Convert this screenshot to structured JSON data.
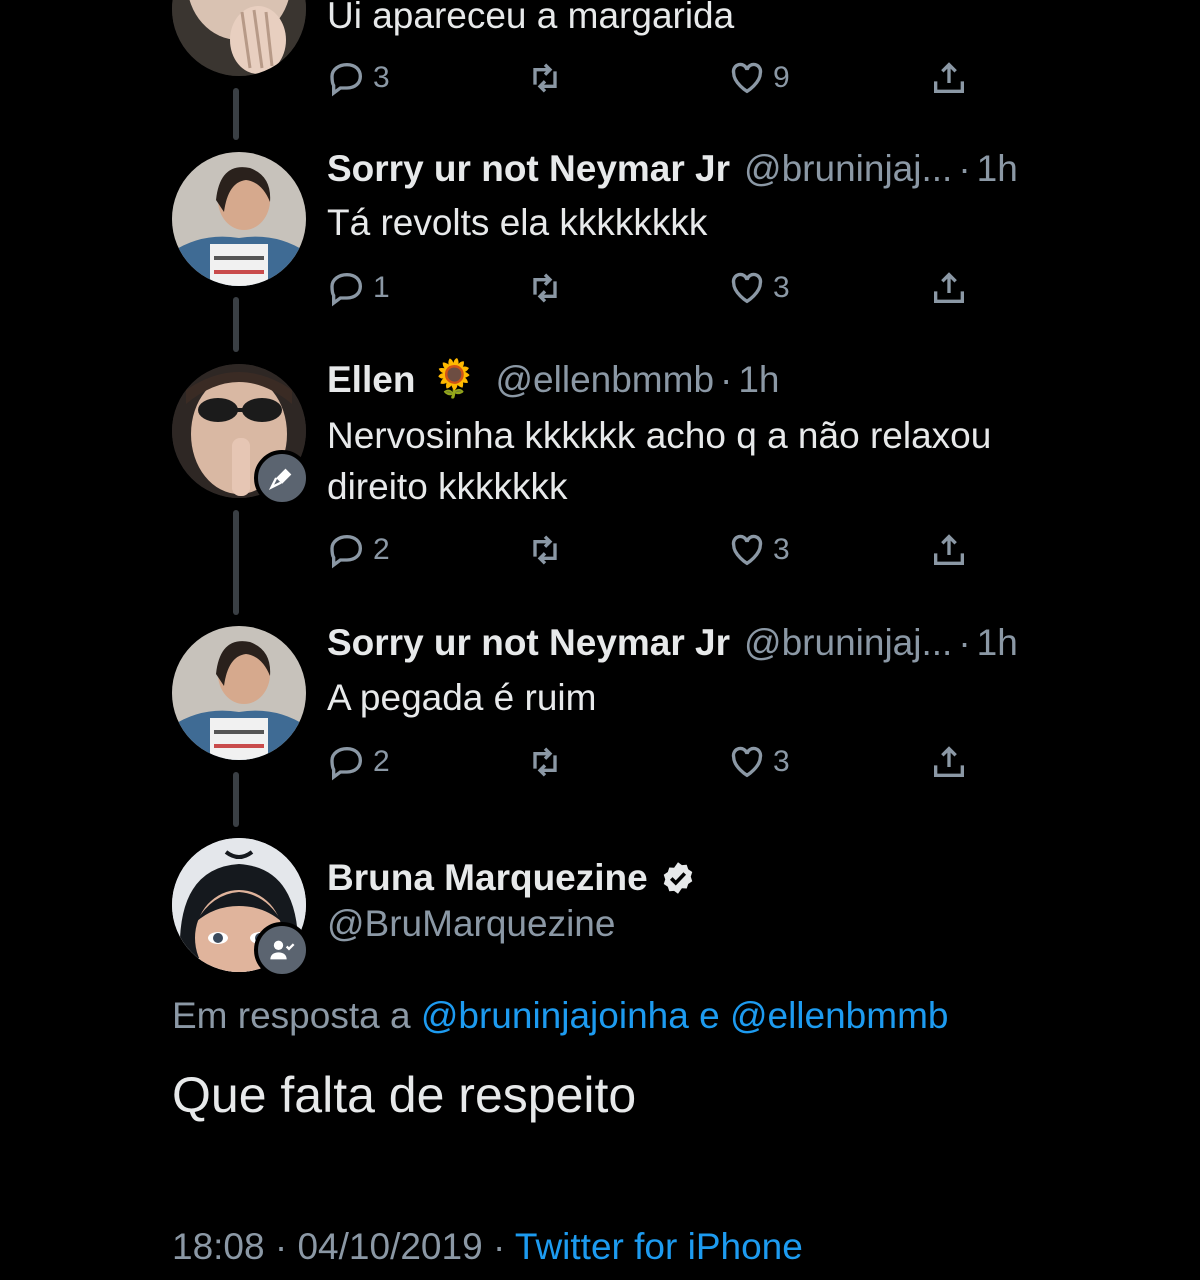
{
  "tweets": [
    {
      "text": "Ui apareceu a margarida",
      "replies": "3",
      "likes": "9"
    },
    {
      "name": "Sorry ur not Neymar Jr",
      "handle": "@bruninjaj...",
      "time": "1h",
      "text": "Tá revolts ela kkkkkkkk",
      "replies": "1",
      "likes": "3"
    },
    {
      "name": "Ellen",
      "emoji": "🌻",
      "handle": "@ellenbmmb",
      "time": "1h",
      "text": "Nervosinha kkkkkk acho q a não relaxou direito kkkkkkk",
      "replies": "2",
      "likes": "3"
    },
    {
      "name": "Sorry ur not Neymar Jr",
      "handle": "@bruninjaj...",
      "time": "1h",
      "text": "A pegada é ruim",
      "replies": "2",
      "likes": "3"
    }
  ],
  "main_tweet": {
    "name": "Bruna Marquezine",
    "handle": "@BruMarquezine",
    "reply_prefix": "Em resposta a",
    "reply_user1": "@bruninjajoinha",
    "reply_and": "e",
    "reply_user2": "@ellenbmmb",
    "text": "Que falta de respeito",
    "time": "18:08",
    "date": "04/10/2019",
    "source": "Twitter for iPhone"
  },
  "separator": "·",
  "icons": {
    "reply": "reply-icon",
    "retweet": "retweet-icon",
    "like": "heart-icon",
    "share": "share-icon",
    "verified": "verified-badge-icon",
    "mic": "microphone-icon",
    "person_check": "person-check-icon"
  },
  "colors": {
    "background": "#000000",
    "text": "#e7e9ea",
    "muted": "#8b98a5",
    "link": "#1d9bf0"
  }
}
